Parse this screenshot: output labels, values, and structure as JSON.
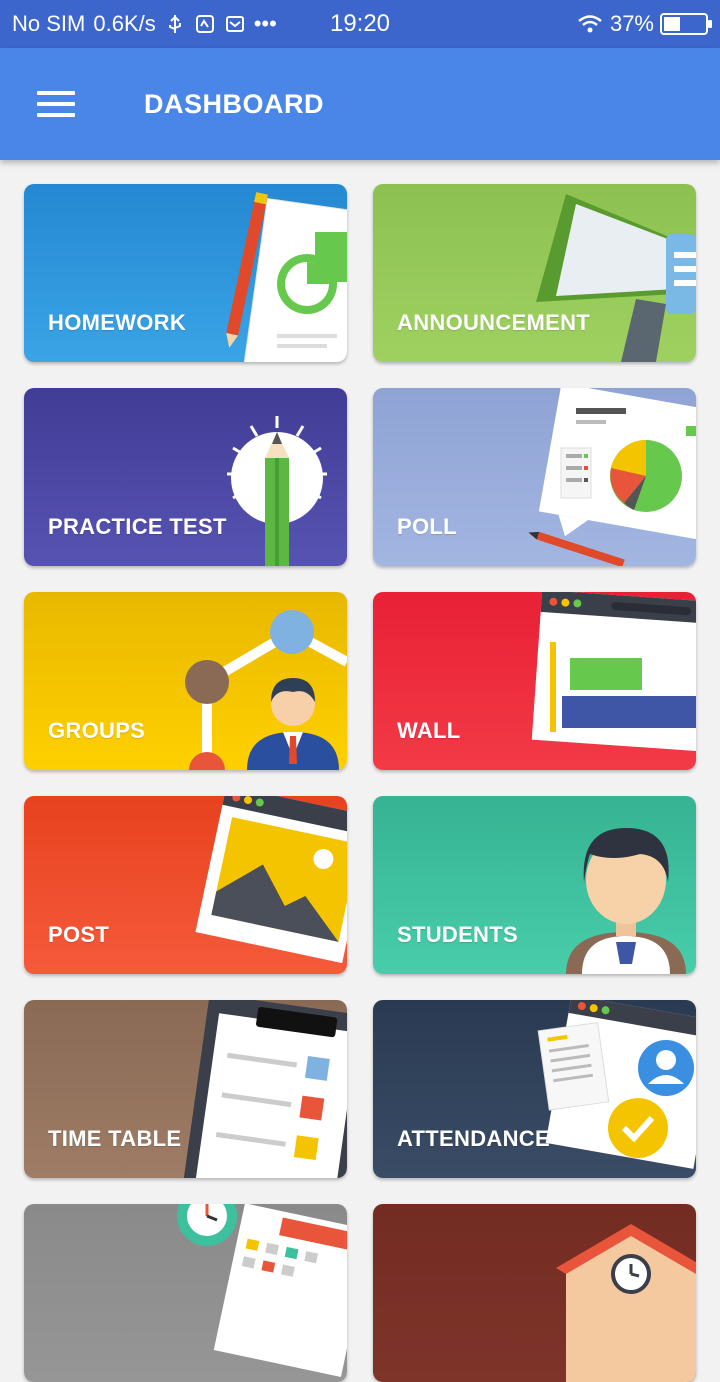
{
  "status_bar": {
    "carrier": "No SIM",
    "net_speed": "0.6K/s",
    "dots": "•••",
    "time": "19:20",
    "battery": "37%"
  },
  "app_bar": {
    "title": "DASHBOARD",
    "menu_icon": "hamburger-menu-icon"
  },
  "tiles": [
    {
      "label": "HOMEWORK",
      "color": "#2e8fd8",
      "icon": "homework-document-icon"
    },
    {
      "label": "ANNOUNCEMENT",
      "color": "#8cc152",
      "icon": "megaphone-icon"
    },
    {
      "label": "PRACTICE TEST",
      "color": "#4a45a0",
      "icon": "pencil-lightbulb-icon"
    },
    {
      "label": "POLL",
      "color": "#94a9d6",
      "icon": "pie-chart-icon"
    },
    {
      "label": "GROUPS",
      "color": "#f5c400",
      "icon": "network-person-icon"
    },
    {
      "label": "WALL",
      "color": "#ec2b3a",
      "icon": "browser-wall-icon"
    },
    {
      "label": "POST",
      "color": "#ee4a2c",
      "icon": "image-post-icon"
    },
    {
      "label": "STUDENTS",
      "color": "#3ec09e",
      "icon": "student-avatar-icon"
    },
    {
      "label": "TIME TABLE",
      "color": "#8a6a55",
      "icon": "clipboard-icon"
    },
    {
      "label": "ATTENDANCE",
      "color": "#2f3f55",
      "icon": "attendance-check-icon"
    },
    {
      "label": "",
      "color": "#8e8e8e",
      "icon": "calendar-gear-icon"
    },
    {
      "label": "",
      "color": "#7a2f26",
      "icon": "school-house-icon"
    }
  ]
}
